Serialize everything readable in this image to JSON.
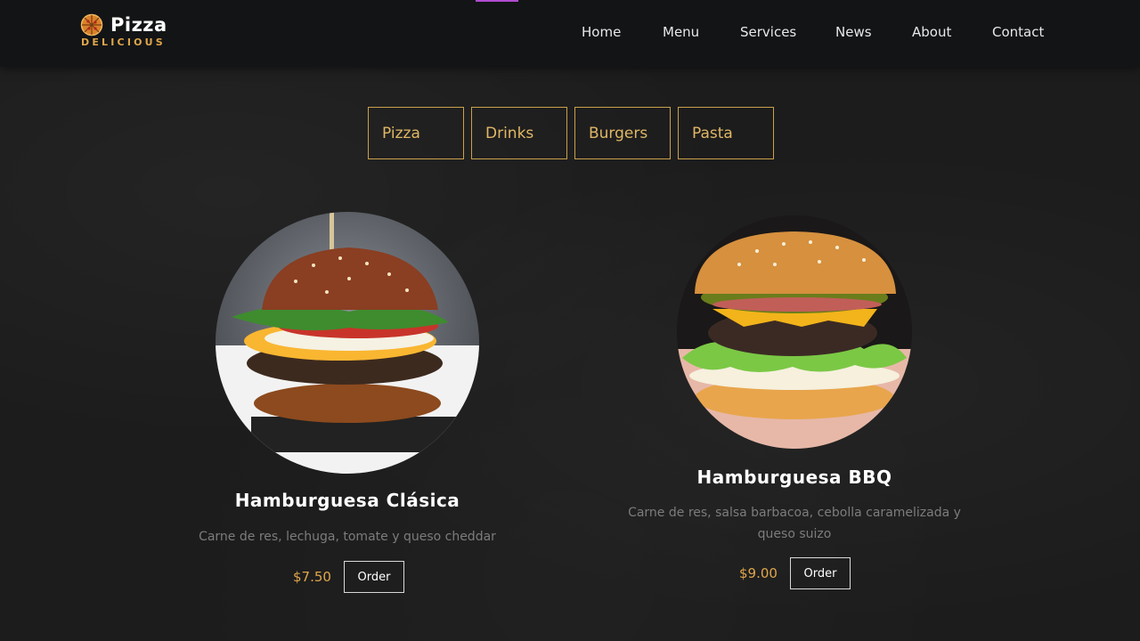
{
  "brand": {
    "name": "Pizza",
    "subtitle": "DELICIOUS",
    "logo_icon": "pizza-icon"
  },
  "nav": {
    "items": [
      "Home",
      "Menu",
      "Services",
      "News",
      "About",
      "Contact"
    ]
  },
  "filters": [
    "Pizza",
    "Drinks",
    "Burgers",
    "Pasta"
  ],
  "products": [
    {
      "title": "Hamburguesa Clásica",
      "description": "Carne de res, lechuga, tomate y queso cheddar",
      "price": "$7.50",
      "order_label": "Order",
      "image_icon": "burger-classic-image"
    },
    {
      "title": "Hamburguesa BBQ",
      "description": "Carne de res, salsa barbacoa, cebolla caramelizada y queso suizo",
      "price": "$9.00",
      "order_label": "Order",
      "image_icon": "burger-bbq-image"
    }
  ],
  "colors": {
    "accent_gold": "#c9a14a",
    "price_gold": "#e0a64b",
    "topbar": "#121416",
    "background": "#1c1c1c"
  }
}
